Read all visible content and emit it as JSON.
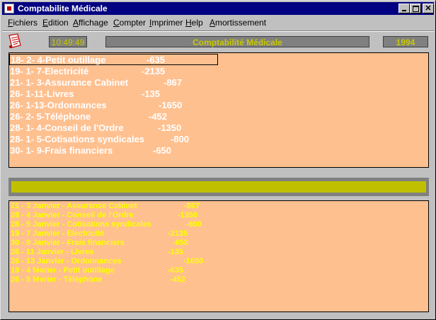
{
  "window": {
    "title": "Comptabilite Médicale"
  },
  "menu": [
    "Fichiers",
    "Edition",
    "Affichage",
    "Compter",
    "Imprimer",
    "Help",
    "Amortissement"
  ],
  "status": {
    "time": "10:49:49",
    "banner": "Comptabilité Médicale",
    "year": "1994"
  },
  "entries": [
    {
      "text": "18- 2- 4-Petit outillage",
      "amount": "-635",
      "selected": true
    },
    {
      "text": "19- 1- 7-Electricité",
      "amount": "-2135"
    },
    {
      "text": "21- 1- 3-Assurance Cabinet",
      "amount": "-867"
    },
    {
      "text": "26- 1-11-Livres",
      "amount": "-135"
    },
    {
      "text": "26- 1-13-Ordonnances",
      "amount": "-1650"
    },
    {
      "text": "26- 2- 5-Téléphone",
      "amount": "-452"
    },
    {
      "text": "28- 1- 4-Conseil de l'Ordre",
      "amount": "-1350"
    },
    {
      "text": "28- 1- 5-Cotisations syndicales",
      "amount": "-800"
    },
    {
      "text": "30- 1- 9-Frais financiers",
      "amount": "-650"
    }
  ],
  "log": [
    {
      "text": "21 -  3 Janvier - Assurance Cabinet",
      "amount": "-867"
    },
    {
      "text": "28 -  4 Janvier - Conseil de l'Ordre",
      "amount": "-1350"
    },
    {
      "text": "28 -  5 Janvier - Cotisations syndicales",
      "amount": "-800"
    },
    {
      "text": "19 -  7 Janvier - Electricité",
      "amount": "-2135"
    },
    {
      "text": "30 -  9 Janvier - Frais financiers",
      "amount": "-650"
    },
    {
      "text": "26 - 11 Janvier - Livres",
      "amount": "-135"
    },
    {
      "text": "26 - 13 Janvier - Ordonnances",
      "amount": "-1650"
    },
    {
      "text": "18 -  4 février - Petit outillage",
      "amount": "-635"
    },
    {
      "text": "26 -  5 février - Téléphone",
      "amount": "-452"
    }
  ],
  "icons": {
    "app": "app-icon",
    "document": "document-icon"
  },
  "colors": {
    "panel": "#ffc090",
    "titlebar": "#000080",
    "status_text": "#c8c800",
    "log_text": "#ffff00"
  }
}
